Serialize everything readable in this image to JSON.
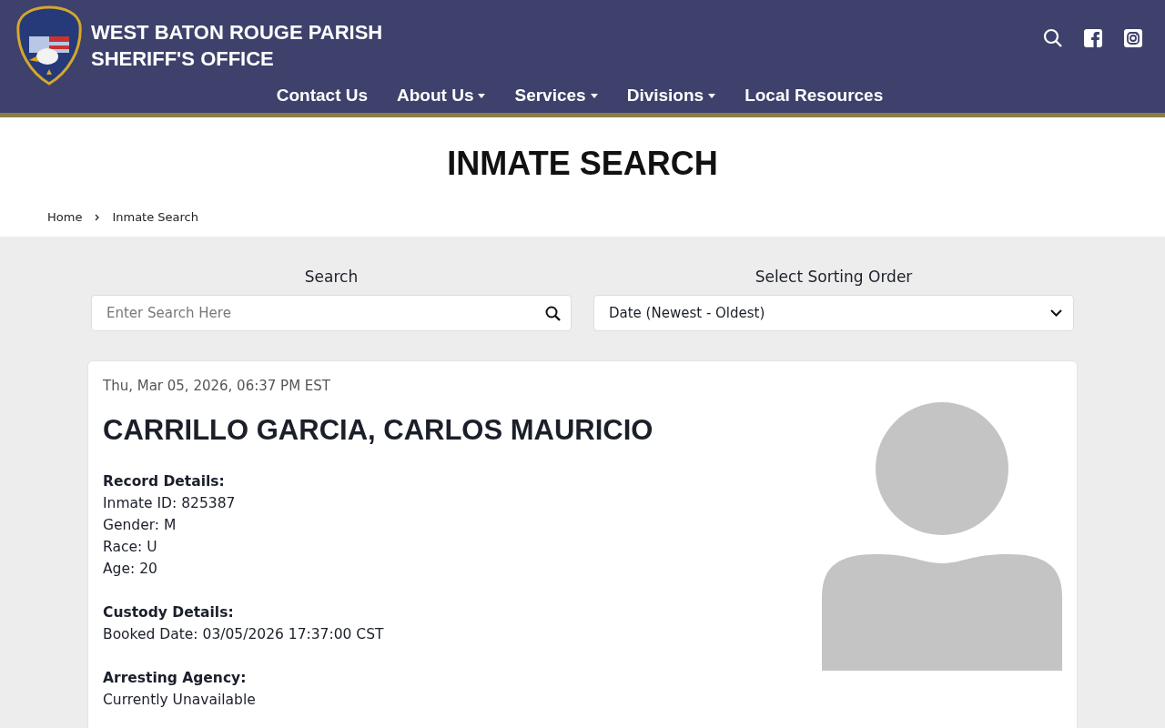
{
  "header": {
    "title_lines": [
      "WEST BATON ROUGE PARISH",
      "SHERIFF'S OFFICE"
    ],
    "nav": [
      {
        "label": "Contact Us",
        "dropdown": false
      },
      {
        "label": "About Us",
        "dropdown": true
      },
      {
        "label": "Services",
        "dropdown": true
      },
      {
        "label": "Divisions",
        "dropdown": true
      },
      {
        "label": "Local Resources",
        "dropdown": false
      }
    ]
  },
  "page_title": "INMATE SEARCH",
  "breadcrumb": [
    "Home",
    "Inmate Search"
  ],
  "search": {
    "label": "Search",
    "placeholder": "Enter Search Here"
  },
  "sort": {
    "label": "Select Sorting Order",
    "value": "Date (Newest - Oldest)"
  },
  "record": {
    "timestamp": "Thu, Mar 05, 2026, 06:37 PM EST",
    "name": "CARRILLO GARCIA, CARLOS MAURICIO",
    "sections": [
      {
        "heading": "Record Details:",
        "lines": [
          "Inmate ID: 825387",
          "Gender: M",
          "Race: U",
          "Age: 20"
        ]
      },
      {
        "heading": "Custody Details:",
        "lines": [
          "Booked Date: 03/05/2026 17:37:00 CST"
        ]
      },
      {
        "heading": "Arresting Agency:",
        "lines": [
          "Currently Unavailable"
        ]
      }
    ]
  }
}
